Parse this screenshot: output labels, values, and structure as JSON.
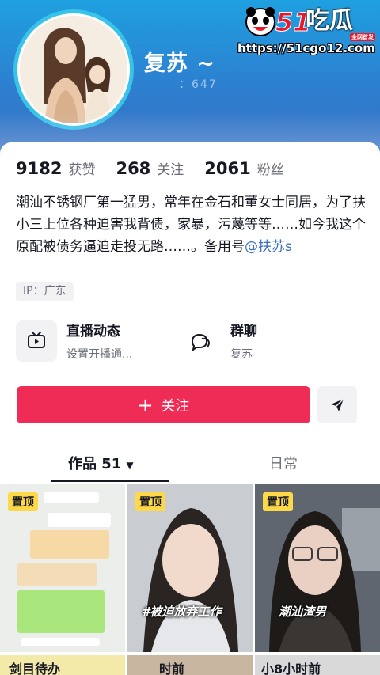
{
  "profile": {
    "nickname": "复苏 ~",
    "uid_fragment": "：647"
  },
  "watermark": {
    "brand_number": "51",
    "brand_name": "吃瓜",
    "tag": "全网首发",
    "url": "https://51cgo12.com"
  },
  "stats": [
    {
      "value": "9182",
      "label": "获赞"
    },
    {
      "value": "268",
      "label": "关注"
    },
    {
      "value": "2061",
      "label": "粉丝"
    }
  ],
  "bio": {
    "text": "潮汕不锈钢厂第一猛男，常年在金石和董女士同居，为了扶小三上位各种迫害我背债，家暴，污蔑等等……如今我这个原配被债务逼迫走投无路……。备用号",
    "mention": "@扶苏s"
  },
  "ip_location": "IP：广东",
  "features": [
    {
      "title": "直播动态",
      "subtitle": "设置开播通...",
      "icon": "tv-icon"
    },
    {
      "title": "群聊",
      "subtitle": "复苏",
      "icon": "chat-bubble-icon"
    }
  ],
  "actions": {
    "follow_label": "关注",
    "follow_color": "#ee2c55",
    "send_icon": "send-icon"
  },
  "tabs": {
    "works_label": "作品 51",
    "daily_label": "日常"
  },
  "videos": [
    {
      "pinned": "置顶",
      "caption": ""
    },
    {
      "pinned": "置顶",
      "caption": "#被迫放弃工作"
    },
    {
      "pinned": "置顶",
      "caption": "潮汕渣男"
    }
  ],
  "videos_row2": [
    "剑目待办",
    "时前",
    "小8小时前"
  ],
  "colors": {
    "header_top": "#1fa0e0",
    "pin_badge": "#fdd94a",
    "mention": "#3b6fbf"
  }
}
